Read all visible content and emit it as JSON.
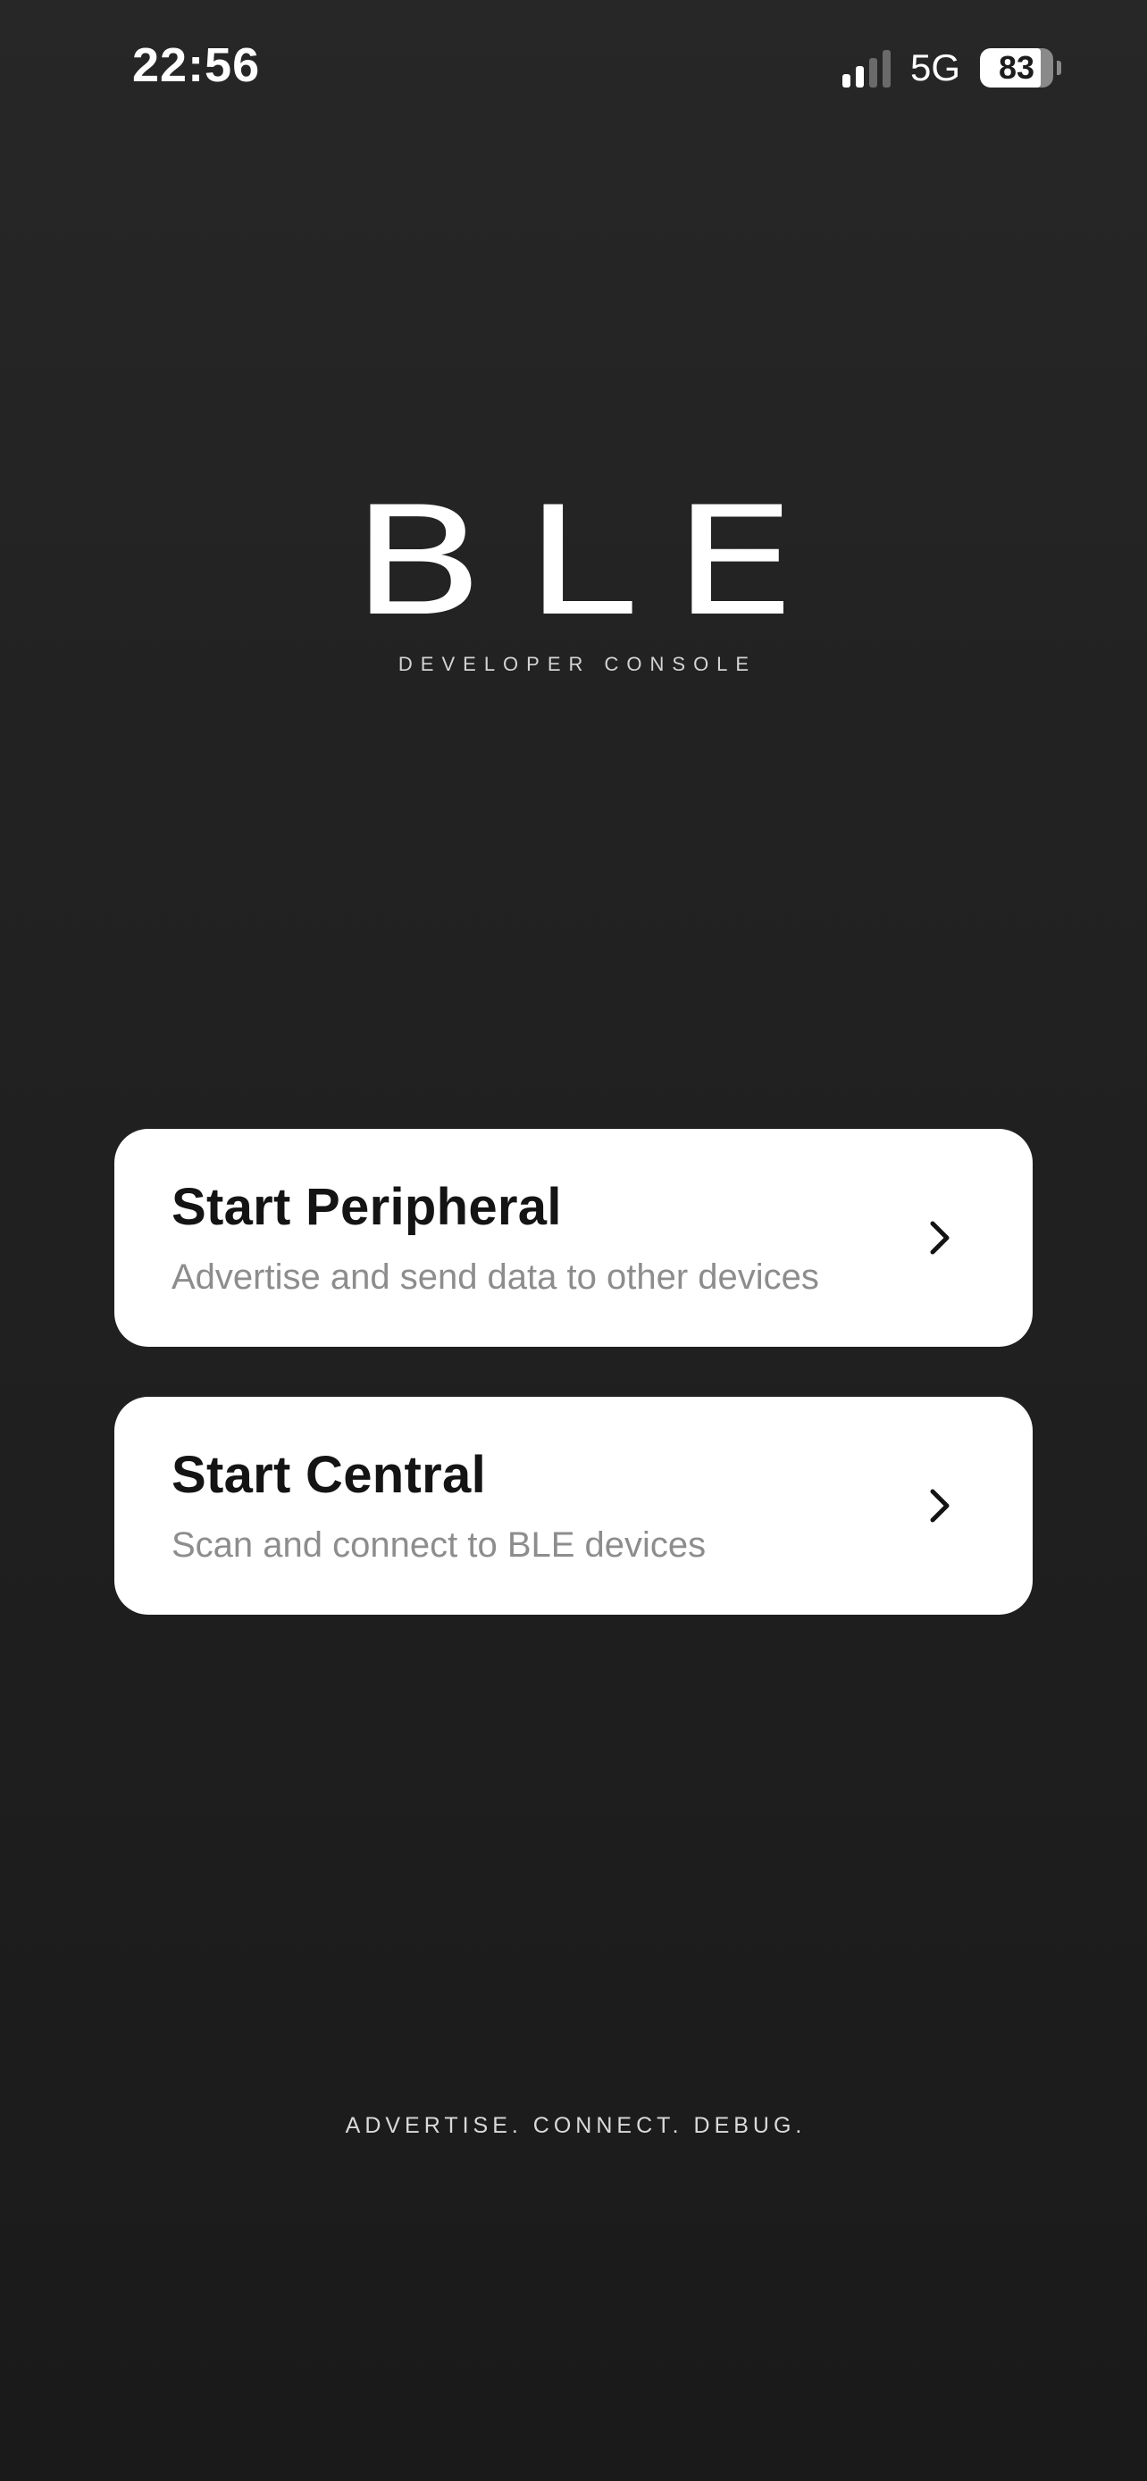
{
  "status_bar": {
    "time": "22:56",
    "network": "5G",
    "battery_level": "83",
    "battery_fraction": 0.83,
    "signal_bars_active": 2,
    "signal_bars_total": 4
  },
  "logo": {
    "title": "BLE",
    "subtitle": "DEVELOPER CONSOLE"
  },
  "actions": [
    {
      "title": "Start Peripheral",
      "subtitle": "Advertise and send data to other devices",
      "icon": "chevron-right-icon"
    },
    {
      "title": "Start Central",
      "subtitle": "Scan and connect to BLE devices",
      "icon": "chevron-right-icon"
    }
  ],
  "tagline": "ADVERTISE. CONNECT. DEBUG.",
  "colors": {
    "background": "#1d1d1d",
    "card_background": "#ffffff",
    "card_title": "#141414",
    "card_subtitle": "#8d8d8d",
    "text_light": "#ffffff"
  }
}
